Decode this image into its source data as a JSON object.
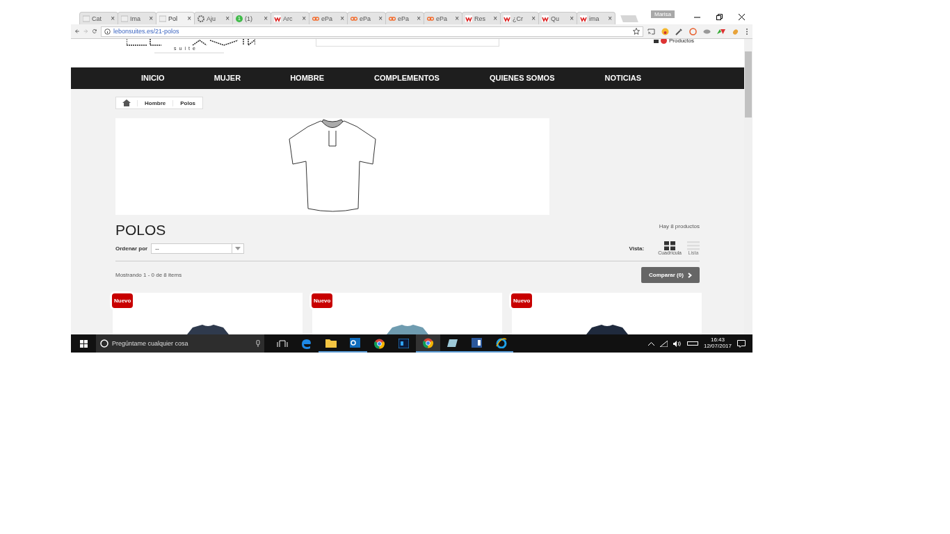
{
  "browser": {
    "tabs": [
      {
        "title": "Cat",
        "selected": false
      },
      {
        "title": "Ima",
        "selected": false
      },
      {
        "title": "Pol",
        "selected": true
      },
      {
        "title": "Aju",
        "selected": false
      },
      {
        "title": "(1)",
        "selected": false
      },
      {
        "title": "Arc",
        "selected": false
      },
      {
        "title": "ePa",
        "selected": false
      },
      {
        "title": "ePa",
        "selected": false
      },
      {
        "title": "ePa",
        "selected": false
      },
      {
        "title": "ePa",
        "selected": false
      },
      {
        "title": "Res",
        "selected": false
      },
      {
        "title": "¿Cr",
        "selected": false
      },
      {
        "title": "Qu",
        "selected": false
      },
      {
        "title": "ima",
        "selected": false
      }
    ],
    "close_glyph": "×",
    "profile": "Marisa",
    "url": "lebonsuites.es/21-polos",
    "badge_count": "1"
  },
  "header": {
    "logo_sub": "suite",
    "cart_label": "Productos"
  },
  "nav": [
    "INICIO",
    "MUJER",
    "HOMBRE",
    "COMPLEMENTOS",
    "QUIENES SOMOS",
    "NOTICIAS"
  ],
  "breadcrumb": [
    "Hombre",
    "Polos"
  ],
  "category": {
    "title": "POLOS",
    "count": "Hay 8 productos",
    "sort_label": "Ordenar por",
    "sort_value": "--",
    "view_label": "Vista:",
    "views": [
      {
        "label": "Cuadrícula",
        "kind": "grid",
        "selected": true
      },
      {
        "label": "Lista",
        "kind": "list",
        "selected": false
      }
    ],
    "showing": "Mostrando 1 - 0 de 8 items",
    "compare": "Comparar (0)"
  },
  "products": [
    {
      "badge": "Nuevo"
    },
    {
      "badge": "Nuevo"
    },
    {
      "badge": "Nuevo"
    }
  ],
  "taskbar": {
    "search_placeholder": "Pregúntame cualquier cosa",
    "time": "16:43",
    "date": "12/07/2017"
  }
}
